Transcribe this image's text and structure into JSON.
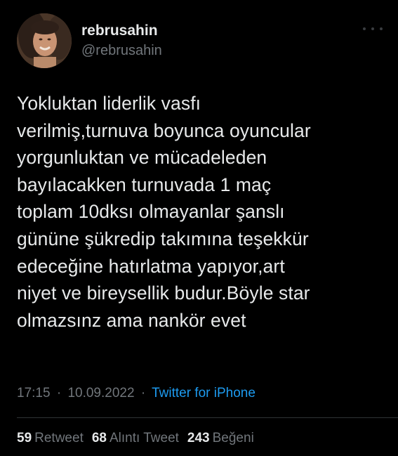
{
  "user": {
    "display_name": "rebrusahin",
    "handle": "@rebrusahin",
    "avatar_icon": "profile-photo"
  },
  "tweet": {
    "text": "Yokluktan liderlik vasfı\nverilmiş,turnuva boyunca oyuncular\nyorgunluktan ve mücadeleden\nbayılacakken  turnuvada 1 maç\ntoplam 10dksı olmayanlar şanslı\ngününe şükredip takımına teşekkür\nedeceğine hatırlatma yapıyor,art\nniyet ve bireysellik budur.Böyle star\nolmazsınz ama nankör evet"
  },
  "meta": {
    "time": "17:15",
    "separator1": "·",
    "date": "10.09.2022",
    "separator2": "·",
    "source": "Twitter for iPhone"
  },
  "stats": {
    "retweets_count": "59",
    "retweets_label": "Retweet",
    "quotes_count": "68",
    "quotes_label": "Alıntı Tweet",
    "likes_count": "243",
    "likes_label": "Beğeni"
  },
  "colors": {
    "background": "#000000",
    "text": "#e7e9ea",
    "secondary": "#71767b",
    "link": "#1d9bf0",
    "divider": "#2f3336"
  }
}
